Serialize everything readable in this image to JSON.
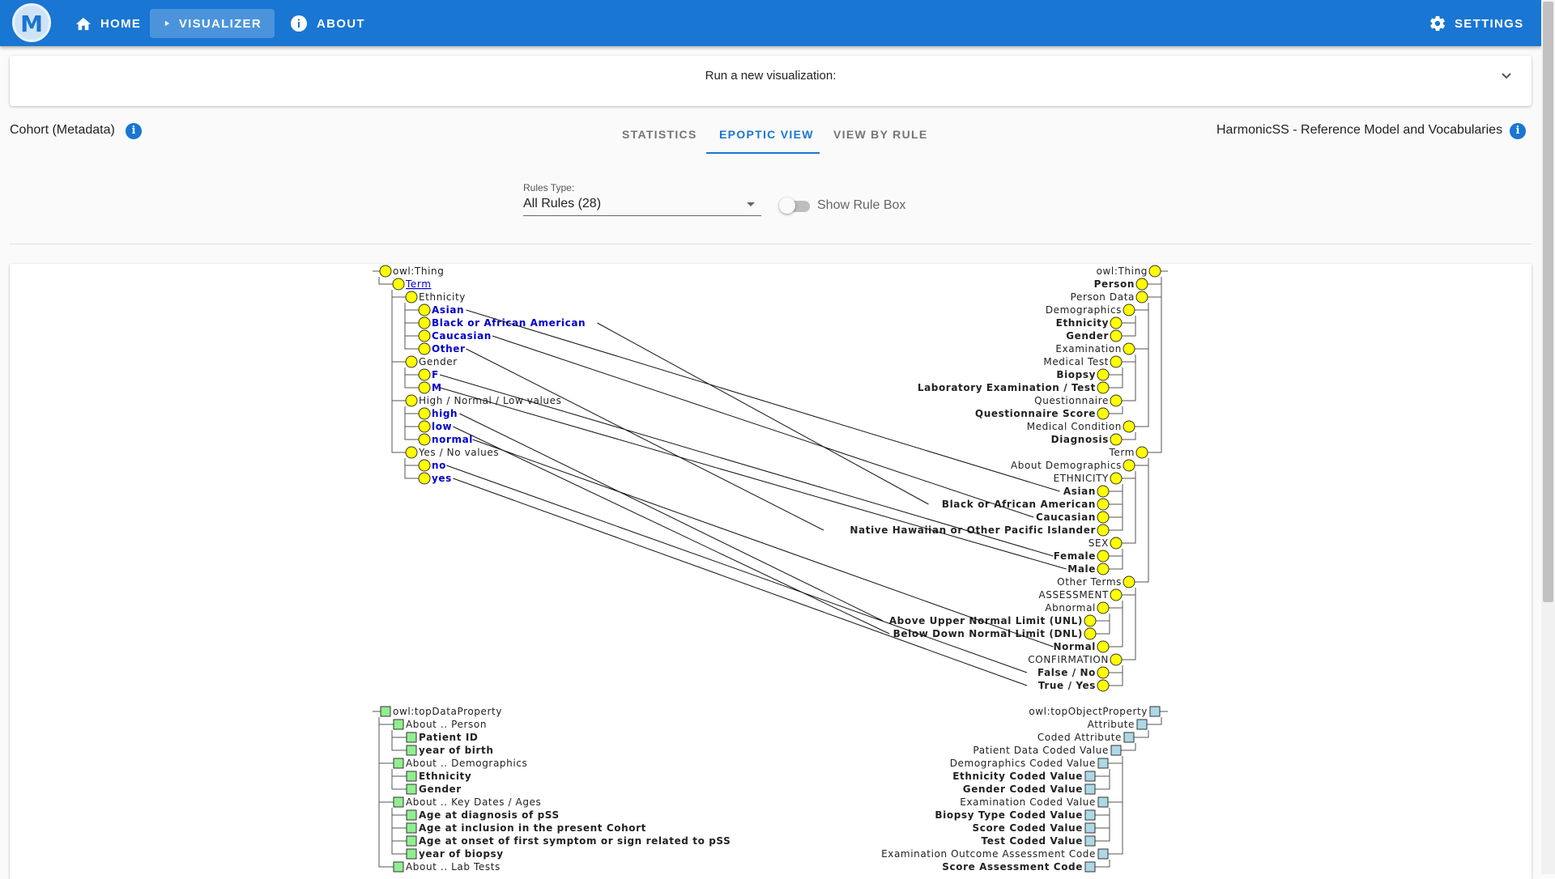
{
  "header": {
    "logo_letter": "M",
    "nav": [
      {
        "label": "HOME",
        "icon": "home-icon"
      },
      {
        "label": "VISUALIZER",
        "icon": "play-icon",
        "active": true
      },
      {
        "label": "ABOUT",
        "icon": "info-icon"
      }
    ],
    "settings_label": "SETTINGS",
    "bar_color": "#1976d2"
  },
  "run_panel": {
    "title": "Run a new visualization:"
  },
  "left_source": {
    "label": "Cohort (Metadata)"
  },
  "right_source": {
    "label": "HarmonicSS - Reference Model and Vocabularies"
  },
  "tabs": [
    {
      "label": "STATISTICS",
      "active": false
    },
    {
      "label": "EPOPTIC VIEW",
      "active": true
    },
    {
      "label": "VIEW BY RULE",
      "active": false
    }
  ],
  "rules_select": {
    "label": "Rules Type:",
    "value": "All Rules (28)"
  },
  "rule_box_toggle": {
    "label": "Show Rule Box",
    "on": false
  },
  "colors": {
    "class_node": "#ffff00",
    "data_property": "#90ee90",
    "object_property": "#add8e6",
    "link_text": "#0000cc"
  },
  "left_class_tree": [
    {
      "label": "owl:Thing",
      "depth": 0
    },
    {
      "label": "Term",
      "depth": 1,
      "link": true
    },
    {
      "label": "Ethnicity",
      "depth": 2
    },
    {
      "label": "Asian",
      "depth": 3,
      "mapped": true
    },
    {
      "label": "Black or African American",
      "depth": 3,
      "mapped": true
    },
    {
      "label": "Caucasian",
      "depth": 3,
      "mapped": true
    },
    {
      "label": "Other",
      "depth": 3,
      "mapped": true
    },
    {
      "label": "Gender",
      "depth": 2
    },
    {
      "label": "F",
      "depth": 3,
      "mapped": true
    },
    {
      "label": "M",
      "depth": 3,
      "mapped": true
    },
    {
      "label": "High / Normal / Low values",
      "depth": 2
    },
    {
      "label": "high",
      "depth": 3,
      "mapped": true
    },
    {
      "label": "low",
      "depth": 3,
      "mapped": true
    },
    {
      "label": "normal",
      "depth": 3,
      "mapped": true
    },
    {
      "label": "Yes / No values",
      "depth": 2
    },
    {
      "label": "no",
      "depth": 3,
      "mapped": true
    },
    {
      "label": "yes",
      "depth": 3,
      "mapped": true
    }
  ],
  "right_class_tree": [
    {
      "label": "owl:Thing",
      "depth": 0
    },
    {
      "label": "Person",
      "depth": 1,
      "bold": true
    },
    {
      "label": "Person Data",
      "depth": 1
    },
    {
      "label": "Demographics",
      "depth": 2
    },
    {
      "label": "Ethnicity",
      "depth": 3,
      "bold": true
    },
    {
      "label": "Gender",
      "depth": 3,
      "bold": true
    },
    {
      "label": "Examination",
      "depth": 2
    },
    {
      "label": "Medical Test",
      "depth": 3
    },
    {
      "label": "Biopsy",
      "depth": 4,
      "bold": true
    },
    {
      "label": "Laboratory Examination / Test",
      "depth": 4,
      "bold": true
    },
    {
      "label": "Questionnaire",
      "depth": 3
    },
    {
      "label": "Questionnaire Score",
      "depth": 4,
      "bold": true
    },
    {
      "label": "Medical Condition",
      "depth": 2
    },
    {
      "label": "Diagnosis",
      "depth": 3,
      "bold": true
    },
    {
      "label": "Term",
      "depth": 1
    },
    {
      "label": "About Demographics",
      "depth": 2
    },
    {
      "label": "ETHNICITY",
      "depth": 3
    },
    {
      "label": "Asian",
      "depth": 4,
      "bold": true
    },
    {
      "label": "Black or African American",
      "depth": 4,
      "bold": true
    },
    {
      "label": "Caucasian",
      "depth": 4,
      "bold": true
    },
    {
      "label": "Native Hawaiian or Other Pacific Islander",
      "depth": 4,
      "bold": true
    },
    {
      "label": "SEX",
      "depth": 3
    },
    {
      "label": "Female",
      "depth": 4,
      "bold": true
    },
    {
      "label": "Male",
      "depth": 4,
      "bold": true
    },
    {
      "label": "Other Terms",
      "depth": 2
    },
    {
      "label": "ASSESSMENT",
      "depth": 3
    },
    {
      "label": "Abnormal",
      "depth": 4
    },
    {
      "label": "Above Upper Normal Limit (UNL)",
      "depth": 5,
      "bold": true
    },
    {
      "label": "Below Down Normal Limit (DNL)",
      "depth": 5,
      "bold": true
    },
    {
      "label": "Normal",
      "depth": 4,
      "bold": true
    },
    {
      "label": "CONFIRMATION",
      "depth": 3
    },
    {
      "label": "False / No",
      "depth": 4,
      "bold": true
    },
    {
      "label": "True / Yes",
      "depth": 4,
      "bold": true
    }
  ],
  "left_property_tree": [
    {
      "label": "owl:topDataProperty",
      "depth": 0
    },
    {
      "label": "About .. Person",
      "depth": 1
    },
    {
      "label": "Patient ID",
      "depth": 2,
      "bold": true
    },
    {
      "label": "year of birth",
      "depth": 2,
      "bold": true
    },
    {
      "label": "About .. Demographics",
      "depth": 1
    },
    {
      "label": "Ethnicity",
      "depth": 2,
      "bold": true
    },
    {
      "label": "Gender",
      "depth": 2,
      "bold": true
    },
    {
      "label": "About .. Key Dates / Ages",
      "depth": 1
    },
    {
      "label": "Age at diagnosis of pSS",
      "depth": 2,
      "bold": true
    },
    {
      "label": "Age at inclusion in the present Cohort",
      "depth": 2,
      "bold": true
    },
    {
      "label": "Age at onset of first symptom or sign related to pSS",
      "depth": 2,
      "bold": true
    },
    {
      "label": "year of biopsy",
      "depth": 2,
      "bold": true
    },
    {
      "label": "About .. Lab Tests",
      "depth": 1
    }
  ],
  "right_property_tree": [
    {
      "label": "owl:topObjectProperty",
      "depth": 0
    },
    {
      "label": "Attribute",
      "depth": 1
    },
    {
      "label": "Coded Attribute",
      "depth": 2
    },
    {
      "label": "Patient Data Coded Value",
      "depth": 3
    },
    {
      "label": "Demographics Coded Value",
      "depth": 4
    },
    {
      "label": "Ethnicity Coded Value",
      "depth": 5,
      "bold": true
    },
    {
      "label": "Gender Coded Value",
      "depth": 5,
      "bold": true
    },
    {
      "label": "Examination Coded Value",
      "depth": 4
    },
    {
      "label": "Biopsy Type Coded Value",
      "depth": 5,
      "bold": true
    },
    {
      "label": "Score Coded Value",
      "depth": 5,
      "bold": true
    },
    {
      "label": "Test Coded Value",
      "depth": 5,
      "bold": true
    },
    {
      "label": "Examination Outcome Assessment Code",
      "depth": 4
    },
    {
      "label": "Score Assessment Code",
      "depth": 5,
      "bold": true
    }
  ],
  "mappings": [
    {
      "from": "Asian",
      "to": "Asian"
    },
    {
      "from": "Black or African American",
      "to": "Black or African American"
    },
    {
      "from": "Caucasian",
      "to": "Caucasian"
    },
    {
      "from": "Other",
      "to": "Native Hawaiian or Other Pacific Islander"
    },
    {
      "from": "F",
      "to": "Female"
    },
    {
      "from": "M",
      "to": "Male"
    },
    {
      "from": "high",
      "to": "Above Upper Normal Limit (UNL)"
    },
    {
      "from": "low",
      "to": "Below Down Normal Limit (DNL)"
    },
    {
      "from": "normal",
      "to": "Normal"
    },
    {
      "from": "no",
      "to": "False / No"
    },
    {
      "from": "yes",
      "to": "True / Yes"
    }
  ]
}
